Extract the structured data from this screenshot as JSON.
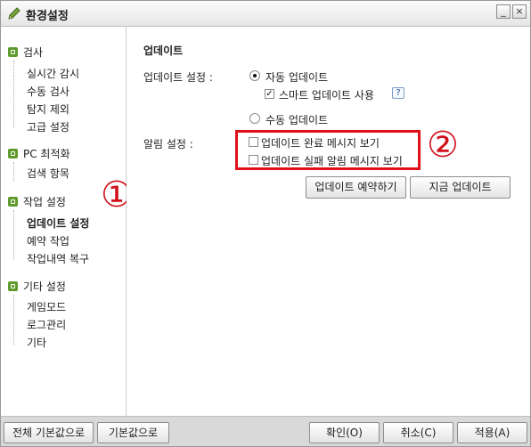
{
  "window": {
    "title": "환경설정",
    "minimize": "_",
    "close": "×"
  },
  "sidebar": {
    "groups": [
      {
        "label": "검사",
        "items": [
          "실시간 감시",
          "수동 검사",
          "탐지 제외",
          "고급 설정"
        ]
      },
      {
        "label": "PC 최적화",
        "items": [
          "검색 항목"
        ]
      },
      {
        "label": "작업 설정",
        "items": [
          "업데이트 설정",
          "예약 작업",
          "작업내역 복구"
        ]
      },
      {
        "label": "기타 설정",
        "items": [
          "게임모드",
          "로그관리",
          "기타"
        ]
      }
    ],
    "active_item": "업데이트 설정"
  },
  "content": {
    "section_title": "업데이트",
    "update_setting_label": "업데이트 설정 :",
    "auto_update": "자동 업데이트",
    "smart_update": "스마트 업데이트 사용",
    "help": "?",
    "manual_update": "수동 업데이트",
    "alert_setting_label": "알림 설정 :",
    "alert_complete": "업데이트 완료 메시지 보기",
    "alert_fail": "업데이트 실패 알림 메시지 보기",
    "schedule_button": "업데이트 예약하기",
    "update_now_button": "지금 업데이트"
  },
  "annotations": {
    "one": "①",
    "two": "②",
    "color": "#e0101a"
  },
  "footer": {
    "all_default": "전체 기본값으로",
    "default": "기본값으로",
    "ok": "확인(O)",
    "cancel": "취소(C)",
    "apply": "적용(A)"
  }
}
